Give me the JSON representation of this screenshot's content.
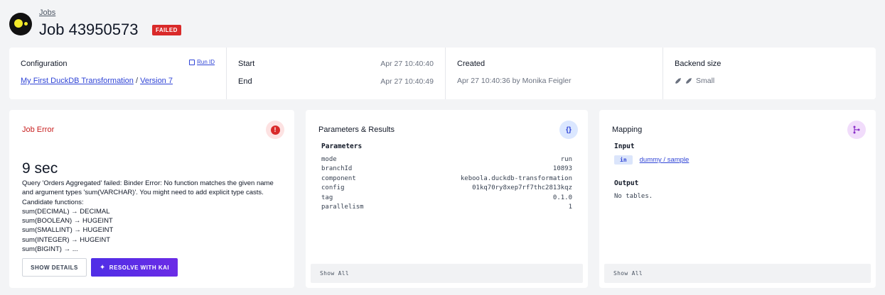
{
  "header": {
    "breadcrumb": "Jobs",
    "title": "Job 43950573",
    "status_badge": "FAILED"
  },
  "info": {
    "configuration": {
      "title": "Configuration",
      "run_id_label": "Run ID",
      "config_link": "My First DuckDB Transformation",
      "separator": "/",
      "version_link": "Version 7"
    },
    "times": {
      "start_label": "Start",
      "start_value": "Apr 27 10:40:40",
      "end_label": "End",
      "end_value": "Apr 27 10:40:49"
    },
    "created": {
      "title": "Created",
      "value": "Apr 27 10:40:36 by Monika Feigler"
    },
    "backend": {
      "title": "Backend size",
      "value": "Small"
    }
  },
  "job_error": {
    "title": "Job Error",
    "duration": "9 sec",
    "message": "Query 'Orders Aggregated' failed: Binder Error: No function matches the given name and argument types 'sum(VARCHAR)'. You might need to add explicit type casts.\nCandidate functions:\nsum(DECIMAL) → DECIMAL\nsum(BOOLEAN) → HUGEINT\nsum(SMALLINT) → HUGEINT\nsum(INTEGER) → HUGEINT\nsum(BIGINT) → ...",
    "show_details_label": "SHOW DETAILS",
    "resolve_label": "RESOLVE WITH KAI"
  },
  "parameters": {
    "title": "Parameters & Results",
    "section_label": "Parameters",
    "rows": [
      {
        "key": "mode",
        "value": "run"
      },
      {
        "key": "branchId",
        "value": "10893"
      },
      {
        "key": "component",
        "value": "keboola.duckdb-transformation"
      },
      {
        "key": "config",
        "value": "01kq70ry8xep7rf7thc2813kqz"
      },
      {
        "key": "tag",
        "value": "0.1.0"
      },
      {
        "key": "parallelism",
        "value": "1"
      }
    ],
    "show_all_label": "Show All"
  },
  "mapping": {
    "title": "Mapping",
    "input_label": "Input",
    "input_tag": "in",
    "input_table": "dummy / sample",
    "output_label": "Output",
    "output_empty": "No tables.",
    "show_all_label": "Show All"
  }
}
